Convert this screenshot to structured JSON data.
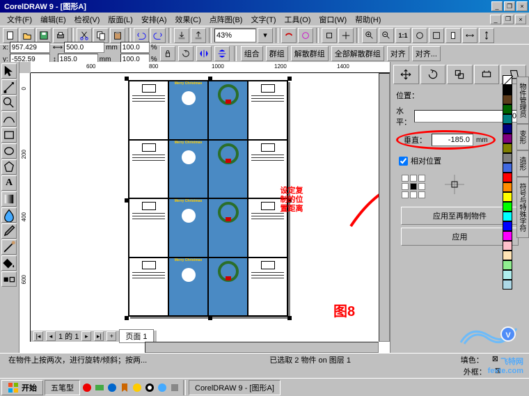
{
  "title": "CorelDRAW 9 - [图形A]",
  "menu": [
    "文件(F)",
    "编辑(E)",
    "检视(V)",
    "版面(L)",
    "安排(A)",
    "效果(C)",
    "点阵图(B)",
    "文字(T)",
    "工具(O)",
    "窗口(W)",
    "帮助(H)"
  ],
  "zoom": "43%",
  "prop": {
    "x": "957.429",
    "y": "-552.59",
    "w": "500.0",
    "h": "185.0",
    "unit": "mm",
    "sx": "100.0",
    "sy": "100.0",
    "pct": "%"
  },
  "group_btns": [
    "组合",
    "群组",
    "解散群组",
    "全部解散群组",
    "对齐",
    "对齐..."
  ],
  "ruler_h": [
    "600",
    "800",
    "1000",
    "1200",
    "1400"
  ],
  "ruler_v": [
    "0",
    "200",
    "400",
    "600"
  ],
  "page_nav": "1 的 1",
  "tab_page": "页面 1",
  "status1": "在物件上按两次，进行旋转/倾斜；按两...",
  "status2": "已选取 2 物件 on 图层 1",
  "fill_label": "填色：",
  "outline_label": "外框：",
  "docker": {
    "pos_title": "位置：",
    "h_label": "水平：",
    "h_value": "0",
    "v_label": "垂直：",
    "v_value": "-185.0",
    "unit": "mm",
    "rel_label": "相对位置",
    "apply_dup": "应用至再制物件",
    "apply": "应用"
  },
  "overlay": {
    "text1": "设定复",
    "text2": "制的位",
    "text3": "置距离",
    "fig": "图8"
  },
  "vtabs": [
    "物件管理员",
    "变形",
    "造形",
    "符号与特殊字符"
  ],
  "colors": [
    "#ffffff",
    "#000000",
    "#00ffff",
    "#ff00ff",
    "#0000ff",
    "#ffff00",
    "#00ff00",
    "#ff0000",
    "#000080",
    "#808000",
    "#008000",
    "#800000",
    "#c0c0c0",
    "#808080"
  ],
  "taskbar": {
    "start": "开始",
    "ime": "五笔型",
    "app": "CorelDRAW 9 - [图形A]"
  },
  "watermark": "飞特网",
  "watermark_url": "fevte.com",
  "card": {
    "merry": "Merry Christmas"
  }
}
